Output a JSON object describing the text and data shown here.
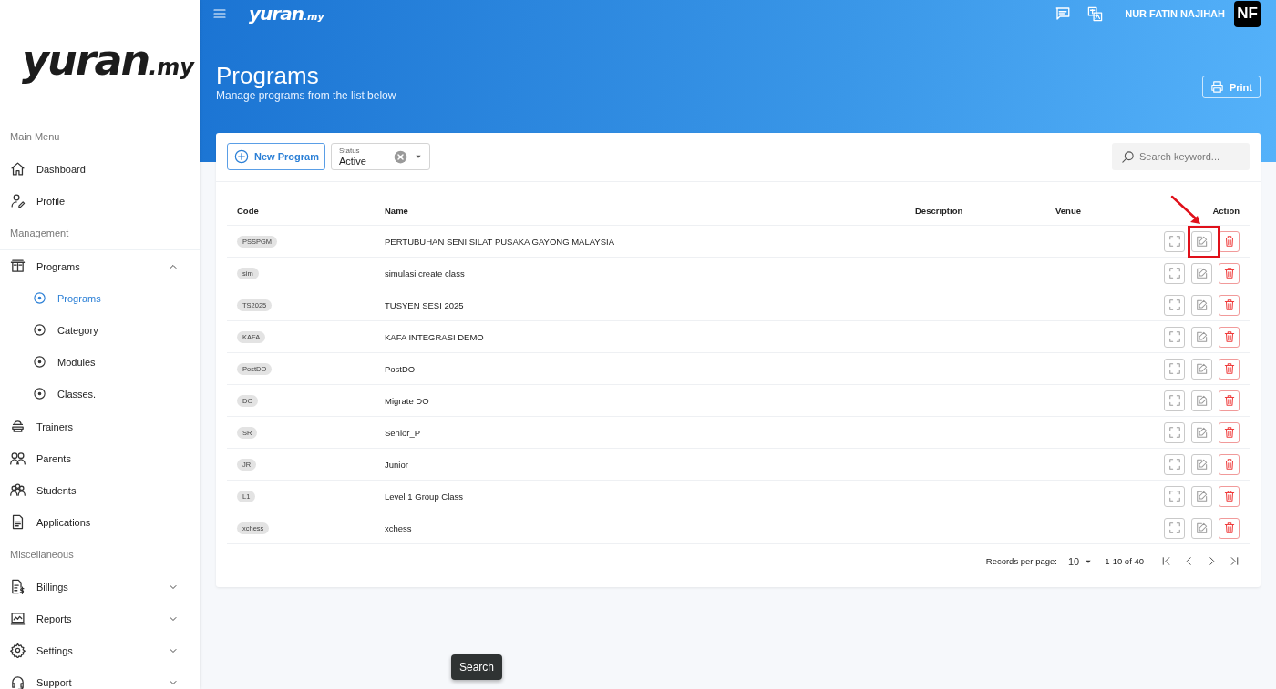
{
  "sidebar": {
    "logo": {
      "main": "yuran",
      "suffix": ".my"
    },
    "sections": [
      {
        "title": "Main Menu",
        "items": [
          {
            "label": "Dashboard",
            "selected": false
          },
          {
            "label": "Profile",
            "selected": false
          }
        ]
      },
      {
        "title": "Management",
        "items": [
          {
            "label": "Programs",
            "selected": false,
            "expanded": true,
            "children": [
              {
                "label": "Programs",
                "selected": true
              },
              {
                "label": "Category",
                "selected": false
              },
              {
                "label": "Modules",
                "selected": false
              },
              {
                "label": "Classes.",
                "selected": false
              }
            ]
          },
          {
            "label": "Trainers",
            "selected": false
          },
          {
            "label": "Parents",
            "selected": false
          },
          {
            "label": "Students",
            "selected": false
          },
          {
            "label": "Applications",
            "selected": false
          }
        ]
      },
      {
        "title": "Miscellaneous",
        "items": [
          {
            "label": "Billings",
            "selected": false,
            "expanded": false
          },
          {
            "label": "Reports",
            "selected": false,
            "expanded": false
          },
          {
            "label": "Settings",
            "selected": false,
            "expanded": false
          },
          {
            "label": "Support",
            "selected": false,
            "expanded": false
          }
        ]
      }
    ]
  },
  "header": {
    "logo": {
      "main": "yuran",
      "suffix": ".my"
    },
    "user_name": "NUR FATIN NAJIHAH",
    "avatar": "NF",
    "title": "Programs",
    "subtitle": "Manage programs from the list below",
    "print_button": "Print"
  },
  "toolbar": {
    "new_button": "New Program",
    "status_filter": {
      "label": "Status",
      "value": "Active"
    },
    "search": {
      "placeholder": "Search keyword..."
    }
  },
  "table": {
    "columns": [
      "Code",
      "Name",
      "Description",
      "Venue",
      "Action"
    ],
    "rows": [
      {
        "code": "PSSPGM",
        "name": "PERTUBUHAN SENI SILAT PUSAKA GAYONG MALAYSIA",
        "highlighted": true
      },
      {
        "code": "sim",
        "name": "simulasi create class",
        "highlighted": false
      },
      {
        "code": "TS2025",
        "name": "TUSYEN SESI 2025",
        "highlighted": false
      },
      {
        "code": "KAFA",
        "name": "KAFA INTEGRASI DEMO",
        "highlighted": false
      },
      {
        "code": "PostDO",
        "name": "PostDO",
        "highlighted": false
      },
      {
        "code": "DO",
        "name": "Migrate DO",
        "highlighted": false
      },
      {
        "code": "SR",
        "name": "Senior_P",
        "highlighted": false
      },
      {
        "code": "JR",
        "name": "Junior",
        "highlighted": false
      },
      {
        "code": "L1",
        "name": "Level 1 Group Class",
        "highlighted": false
      },
      {
        "code": "xchess",
        "name": "xchess",
        "highlighted": false
      }
    ]
  },
  "pagination": {
    "label": "Records per page:",
    "per_page": "10",
    "range": "1-10 of 40"
  },
  "floating_button": "Search"
}
